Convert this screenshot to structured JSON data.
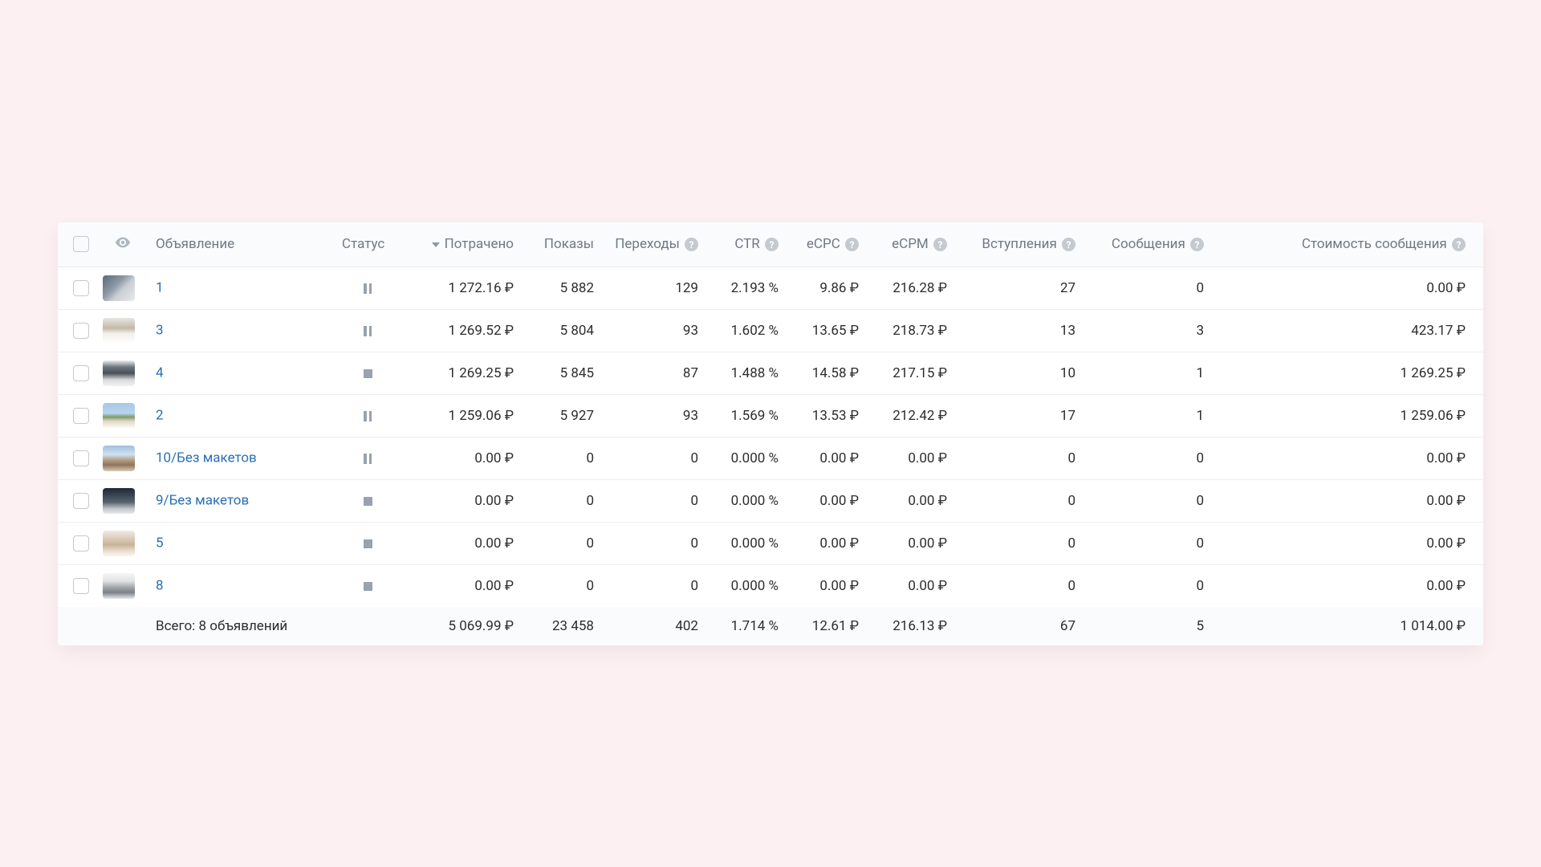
{
  "header": {
    "col_ad": "Объявление",
    "col_status": "Статус",
    "col_spent": "Потрачено",
    "col_impressions": "Показы",
    "col_clicks": "Переходы",
    "col_ctr": "CTR",
    "col_ecpc": "eCPC",
    "col_ecpm": "eCPM",
    "col_joins": "Вступления",
    "col_messages": "Сообщения",
    "col_msg_cost": "Стоимость сообщения"
  },
  "rows": [
    {
      "name": "1",
      "status": "pause",
      "spent": "1 272.16 ₽",
      "impressions": "5 882",
      "clicks": "129",
      "ctr": "2.193 %",
      "ecpc": "9.86 ₽",
      "ecpm": "216.28 ₽",
      "joins": "27",
      "messages": "0",
      "msg_cost": "0.00 ₽"
    },
    {
      "name": "3",
      "status": "pause",
      "spent": "1 269.52 ₽",
      "impressions": "5 804",
      "clicks": "93",
      "ctr": "1.602 %",
      "ecpc": "13.65 ₽",
      "ecpm": "218.73 ₽",
      "joins": "13",
      "messages": "3",
      "msg_cost": "423.17 ₽"
    },
    {
      "name": "4",
      "status": "stop",
      "spent": "1 269.25 ₽",
      "impressions": "5 845",
      "clicks": "87",
      "ctr": "1.488 %",
      "ecpc": "14.58 ₽",
      "ecpm": "217.15 ₽",
      "joins": "10",
      "messages": "1",
      "msg_cost": "1 269.25 ₽"
    },
    {
      "name": "2",
      "status": "pause",
      "spent": "1 259.06 ₽",
      "impressions": "5 927",
      "clicks": "93",
      "ctr": "1.569 %",
      "ecpc": "13.53 ₽",
      "ecpm": "212.42 ₽",
      "joins": "17",
      "messages": "1",
      "msg_cost": "1 259.06 ₽"
    },
    {
      "name": "10/Без макетов",
      "status": "pause",
      "spent": "0.00 ₽",
      "impressions": "0",
      "clicks": "0",
      "ctr": "0.000 %",
      "ecpc": "0.00 ₽",
      "ecpm": "0.00 ₽",
      "joins": "0",
      "messages": "0",
      "msg_cost": "0.00 ₽"
    },
    {
      "name": "9/Без макетов",
      "status": "stop",
      "spent": "0.00 ₽",
      "impressions": "0",
      "clicks": "0",
      "ctr": "0.000 %",
      "ecpc": "0.00 ₽",
      "ecpm": "0.00 ₽",
      "joins": "0",
      "messages": "0",
      "msg_cost": "0.00 ₽"
    },
    {
      "name": "5",
      "status": "stop",
      "spent": "0.00 ₽",
      "impressions": "0",
      "clicks": "0",
      "ctr": "0.000 %",
      "ecpc": "0.00 ₽",
      "ecpm": "0.00 ₽",
      "joins": "0",
      "messages": "0",
      "msg_cost": "0.00 ₽"
    },
    {
      "name": "8",
      "status": "stop",
      "spent": "0.00 ₽",
      "impressions": "0",
      "clicks": "0",
      "ctr": "0.000 %",
      "ecpc": "0.00 ₽",
      "ecpm": "0.00 ₽",
      "joins": "0",
      "messages": "0",
      "msg_cost": "0.00 ₽"
    }
  ],
  "totals": {
    "label": "Всего: 8 объявлений",
    "spent": "5 069.99 ₽",
    "impressions": "23 458",
    "clicks": "402",
    "ctr": "1.714 %",
    "ecpc": "12.61 ₽",
    "ecpm": "216.13 ₽",
    "joins": "67",
    "messages": "5",
    "msg_cost": "1 014.00 ₽"
  }
}
